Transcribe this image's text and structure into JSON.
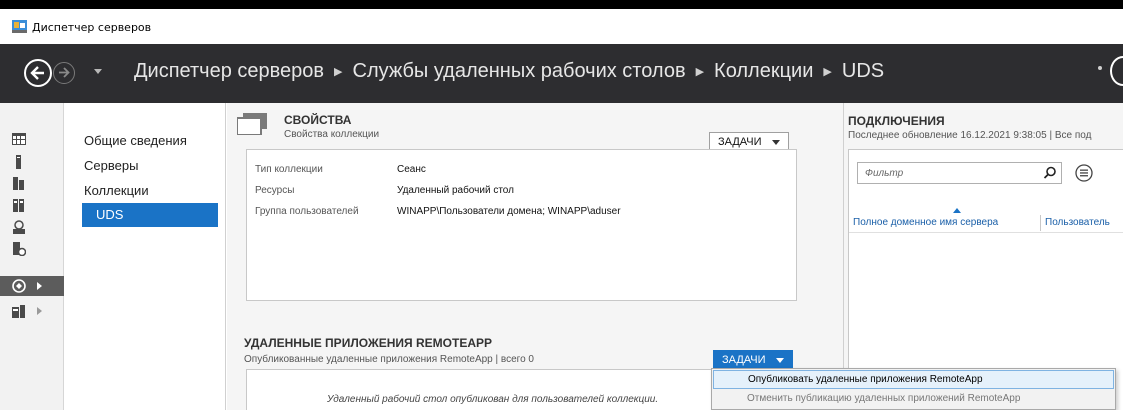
{
  "window": {
    "title": "Диспетчер серверов",
    "icon": "server-manager-icon"
  },
  "nav": {
    "breadcrumb": [
      "Диспетчер серверов",
      "Службы удаленных рабочих столов",
      "Коллекции",
      "UDS"
    ]
  },
  "rail": {
    "items": [
      {
        "icon": "dashboard-icon"
      },
      {
        "icon": "local-server-icon"
      },
      {
        "icon": "all-servers-icon"
      },
      {
        "icon": "file-services-icon"
      },
      {
        "icon": "iis-icon"
      },
      {
        "icon": "remote-desktop-icon"
      },
      {
        "icon": "rds-active-icon",
        "active": true
      },
      {
        "icon": "server-group-icon"
      }
    ]
  },
  "leftnav": {
    "items": [
      "Общие сведения",
      "Серверы",
      "Коллекции",
      "UDS"
    ],
    "selected": "UDS"
  },
  "properties": {
    "title": "СВОЙСТВА",
    "subtitle": "Свойства коллекции",
    "tasks_label": "ЗАДАЧИ",
    "rows": [
      {
        "key": "Тип коллекции",
        "value": "Сеанс"
      },
      {
        "key": "Ресурсы",
        "value": "Удаленный рабочий стол"
      },
      {
        "key": "Группа пользователей",
        "value": "WINAPP\\Пользователи домена; WINAPP\\aduser"
      }
    ]
  },
  "remoteapp": {
    "title": "УДАЛЕННЫЕ ПРИЛОЖЕНИЯ REMOTEAPP",
    "subtitle": "Опубликованные удаленные приложения RemoteApp | всего 0",
    "tasks_label": "ЗАДАЧИ",
    "empty_message": "Удаленный рабочий стол опубликован для пользователей коллекции."
  },
  "connections": {
    "title": "ПОДКЛЮЧЕНИЯ",
    "subtitle": "Последнее обновление 16.12.2021 9:38:05 | Все под",
    "filter_placeholder": "Фильтр",
    "columns": [
      "Полное доменное имя сервера",
      "Пользователь"
    ]
  },
  "menu": {
    "items": [
      {
        "label": "Опубликовать удаленные приложения RemoteApp",
        "enabled": true
      },
      {
        "label": "Отменить публикацию удаленных приложений RemoteApp",
        "enabled": false
      }
    ]
  },
  "colors": {
    "accent": "#1a73c6",
    "header_bg": "#2d2d30"
  }
}
